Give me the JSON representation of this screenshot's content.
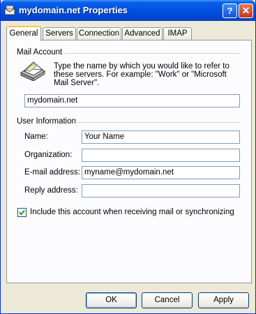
{
  "window": {
    "title": "mydomain.net Properties",
    "help_label": "?",
    "close_label": "✕"
  },
  "tabs": [
    "General",
    "Servers",
    "Connection",
    "Advanced",
    "IMAP"
  ],
  "mail_account": {
    "group_label": "Mail Account",
    "description": "Type the name by which you would like to refer to these servers.  For example: \"Work\" or \"Microsoft Mail Server\".",
    "account_name_value": "mydomain.net"
  },
  "user_info": {
    "group_label": "User Information",
    "name_label": "Name:",
    "name_value": "Your Name",
    "organization_label": "Organization:",
    "organization_value": "",
    "email_label": "E-mail address:",
    "email_value": "myname@mydomain.net",
    "reply_label": "Reply address:",
    "reply_value": ""
  },
  "include_account": {
    "label": "Include this account when receiving mail or synchronizing",
    "checked": true
  },
  "buttons": {
    "ok": "OK",
    "cancel": "Cancel",
    "apply": "Apply"
  }
}
